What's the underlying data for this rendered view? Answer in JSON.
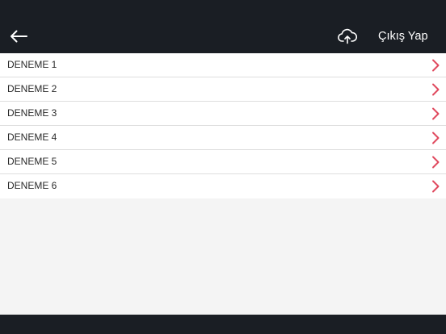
{
  "header": {
    "back_icon": "arrow-left-icon",
    "upload_icon": "cloud-upload-icon",
    "logout_label": "Çıkış Yap",
    "background_color": "#1a1e24"
  },
  "list": {
    "items": [
      {
        "label": "DENEME 1"
      },
      {
        "label": "DENEME 2"
      },
      {
        "label": "DENEME 3"
      },
      {
        "label": "DENEME 4"
      },
      {
        "label": "DENEME 5"
      },
      {
        "label": "DENEME 6"
      }
    ],
    "chevron_icon": "chevron-right-icon",
    "accent_color": "#e04a5f"
  }
}
